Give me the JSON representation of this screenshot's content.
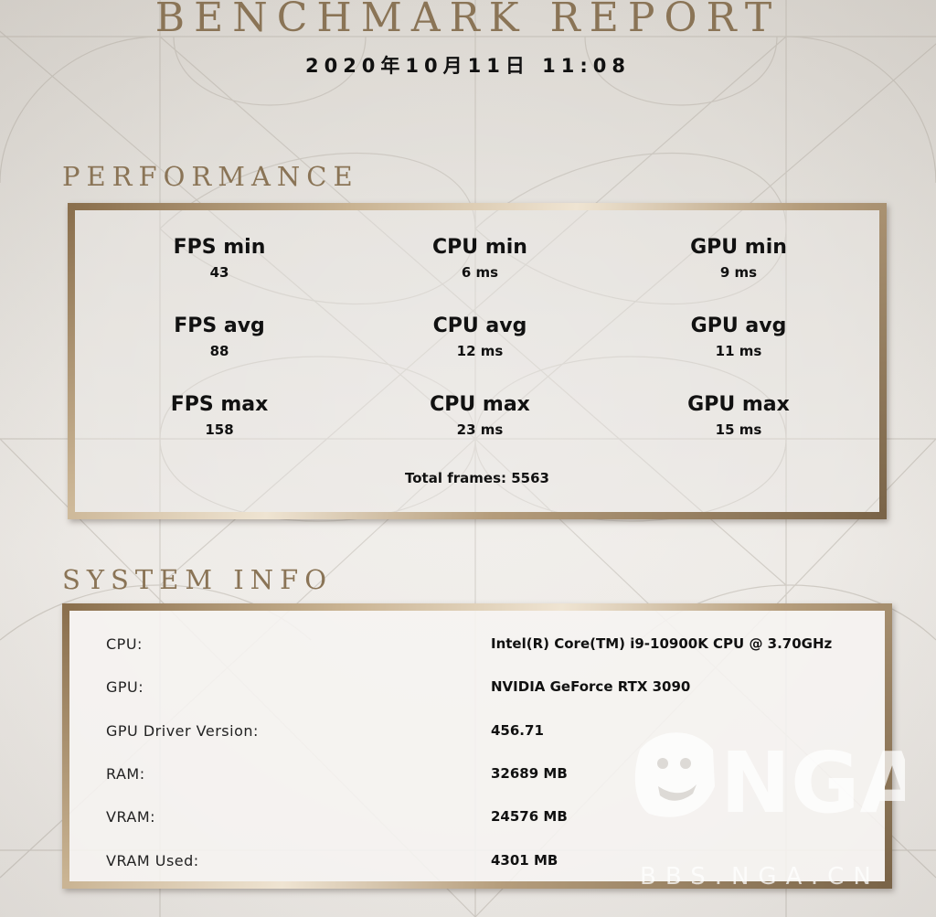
{
  "header": {
    "title": "BENCHMARK REPORT",
    "datetime": "2020年10月11日 11:08"
  },
  "performance": {
    "section_title": "PERFORMANCE",
    "metrics": [
      {
        "label": "FPS min",
        "value": "43"
      },
      {
        "label": "CPU min",
        "value": "6 ms"
      },
      {
        "label": "GPU min",
        "value": "9 ms"
      },
      {
        "label": "FPS avg",
        "value": "88"
      },
      {
        "label": "CPU avg",
        "value": "12 ms"
      },
      {
        "label": "GPU avg",
        "value": "11 ms"
      },
      {
        "label": "FPS max",
        "value": "158"
      },
      {
        "label": "CPU max",
        "value": "23 ms"
      },
      {
        "label": "GPU max",
        "value": "15 ms"
      }
    ],
    "total_frames": "Total frames: 5563"
  },
  "system_info": {
    "section_title": "SYSTEM INFO",
    "rows": [
      {
        "key": "CPU:",
        "value": "Intel(R) Core(TM) i9-10900K CPU @ 3.70GHz"
      },
      {
        "key": "GPU:",
        "value": "NVIDIA GeForce RTX 3090"
      },
      {
        "key": "GPU Driver Version:",
        "value": "456.71"
      },
      {
        "key": "RAM:",
        "value": "32689 MB"
      },
      {
        "key": "VRAM:",
        "value": "24576 MB"
      },
      {
        "key": "VRAM Used:",
        "value": "4301 MB"
      }
    ]
  },
  "watermark": {
    "logo_text": "NGA",
    "site_text": "BBS.NGA.CN"
  },
  "colors": {
    "title_gold": "#8a7456",
    "frame_dark": "#7a6448",
    "frame_light": "#efe4d2",
    "text": "#111111"
  }
}
